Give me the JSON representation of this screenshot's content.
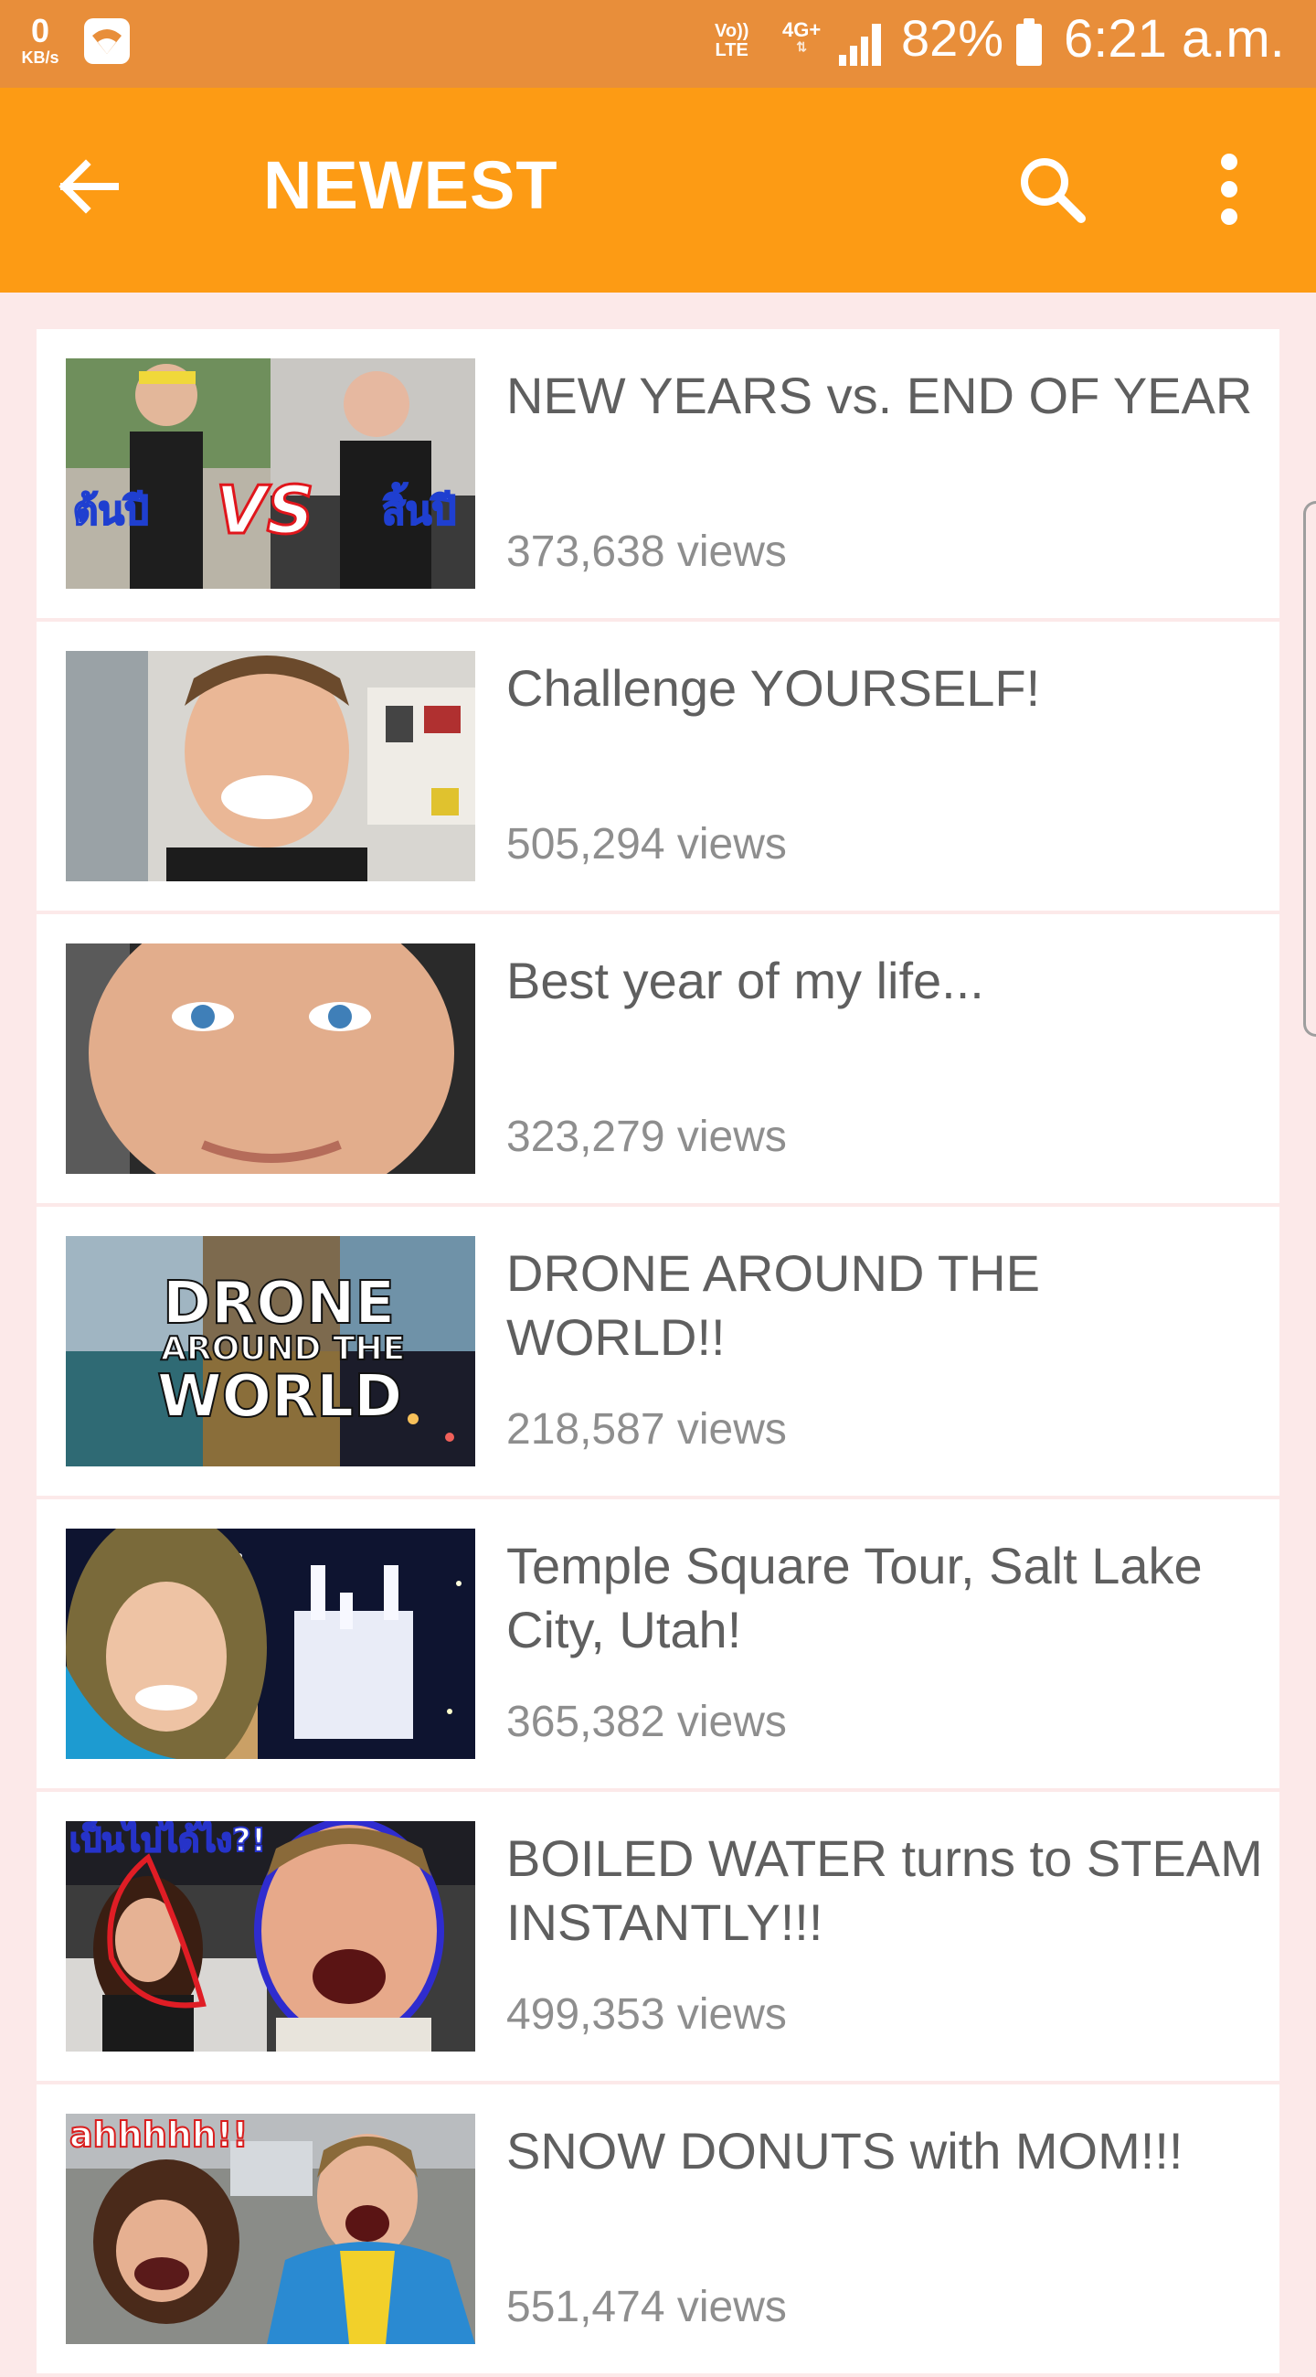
{
  "status_bar": {
    "net_speed": "0",
    "net_speed_unit": "KB/s",
    "volte_top": "Vo))",
    "volte_bottom": "LTE",
    "network": "4G+",
    "battery": "82%",
    "time": "6:21 a.m."
  },
  "app_bar": {
    "title": "NEWEST",
    "back_icon": "arrow-left-icon",
    "search_icon": "search-icon",
    "more_icon": "more-vert-icon"
  },
  "colors": {
    "status_bar": "#e88e3a",
    "app_bar": "#fd9b14",
    "background": "#fce9e9",
    "title_text": "#5f5f5f",
    "views_text": "#8e8e8e"
  },
  "videos": [
    {
      "title": "NEW YEARS vs. END OF YEAR",
      "views": "373,638 views",
      "thumb_text": [
        "ต้นปี",
        "VS",
        "สิ้นปี"
      ]
    },
    {
      "title": "Challenge YOURSELF!",
      "views": "505,294 views",
      "thumb_text": []
    },
    {
      "title": "Best year of my life...",
      "views": "323,279 views",
      "thumb_text": []
    },
    {
      "title": "DRONE AROUND THE WORLD!!",
      "views": "218,587 views",
      "thumb_text": [
        "DRONE",
        "AROUND THE",
        "WORLD"
      ]
    },
    {
      "title": "Temple Square Tour, Salt Lake City, Utah!",
      "views": "365,382 views",
      "thumb_text": []
    },
    {
      "title": "BOILED WATER turns to STEAM INSTANTLY!!!",
      "views": "499,353 views",
      "thumb_text": [
        "เป็นไปได้ไง?!"
      ]
    },
    {
      "title": "SNOW DONUTS with MOM!!!",
      "views": "551,474 views",
      "thumb_text": [
        "ahhhhh!!"
      ]
    }
  ]
}
